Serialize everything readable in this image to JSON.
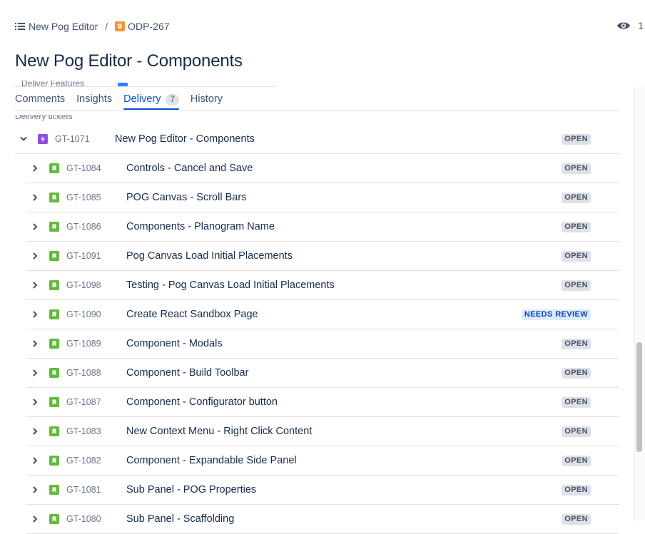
{
  "breadcrumb": {
    "project": "New Pog Editor",
    "separator": "/",
    "issue_key": "ODP-267"
  },
  "watchers": {
    "count": "1"
  },
  "page_title": "New Pog Editor - Components",
  "partial_text": "Deliver Features",
  "tabs": [
    {
      "label": "Comments"
    },
    {
      "label": "Insights"
    },
    {
      "label": "Delivery",
      "count": "7"
    },
    {
      "label": "History"
    }
  ],
  "section_label": "Delivery tickets",
  "parent": {
    "key": "GT-1071",
    "summary": "New Pog Editor - Components",
    "status": "OPEN"
  },
  "children": [
    {
      "key": "GT-1084",
      "summary": "Controls - Cancel and Save",
      "status": "OPEN"
    },
    {
      "key": "GT-1085",
      "summary": "POG Canvas - Scroll Bars",
      "status": "OPEN"
    },
    {
      "key": "GT-1086",
      "summary": "Components - Planogram Name",
      "status": "OPEN"
    },
    {
      "key": "GT-1091",
      "summary": "Pog Canvas Load Initial Placements",
      "status": "OPEN"
    },
    {
      "key": "GT-1098",
      "summary": "Testing - Pog Canvas Load Initial Placements",
      "status": "OPEN"
    },
    {
      "key": "GT-1090",
      "summary": "Create React Sandbox Page",
      "status": "NEEDS REVIEW"
    },
    {
      "key": "GT-1089",
      "summary": "Component - Modals",
      "status": "OPEN"
    },
    {
      "key": "GT-1088",
      "summary": "Component - Build Toolbar",
      "status": "OPEN"
    },
    {
      "key": "GT-1087",
      "summary": "Component - Configurator button",
      "status": "OPEN"
    },
    {
      "key": "GT-1083",
      "summary": "New Context Menu - Right Click Content",
      "status": "OPEN"
    },
    {
      "key": "GT-1082",
      "summary": "Component - Expandable Side Panel",
      "status": "OPEN"
    },
    {
      "key": "GT-1081",
      "summary": "Sub Panel - POG Properties",
      "status": "OPEN"
    },
    {
      "key": "GT-1080",
      "summary": "Sub Panel - Scaffolding",
      "status": "OPEN"
    }
  ],
  "colors": {
    "accent": "#0052cc",
    "story_icon": "#63ba3c",
    "epic_icon": "#904ee2",
    "project_icon": "#f79232",
    "status_open_bg": "#dfe1e6",
    "status_review_bg": "#deebff"
  },
  "icons": {
    "breadcrumb_project": "list-icon",
    "breadcrumb_issue": "location-pin-icon",
    "watch": "eye-icon",
    "expand": "chevron-right-icon",
    "collapse": "chevron-down-icon",
    "parent_type": "lightning-icon",
    "child_type": "bookmark-icon"
  }
}
